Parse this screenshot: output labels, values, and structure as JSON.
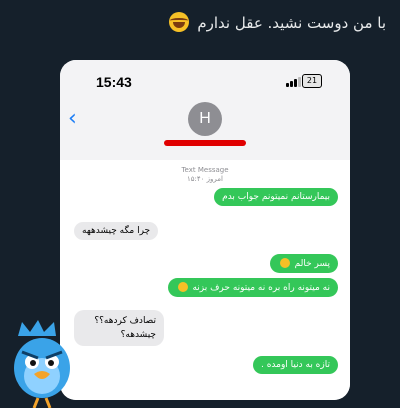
{
  "tweet": {
    "text": "با من دوست نشید. عقل ندارم",
    "emoji": "laugh-cry-icon"
  },
  "status_bar": {
    "time": "15:43",
    "battery": "21"
  },
  "contact": {
    "initial": "H"
  },
  "thread_meta": {
    "line1": "Text Message",
    "line2": "امروز ۱۵:۴۰"
  },
  "messages": [
    {
      "side": "out",
      "text": "بیمارستانم نمیتونم جواب بدم"
    },
    {
      "side": "in",
      "text": "چرا مگه چیشدهھه"
    },
    {
      "side": "out",
      "text": "پسر خالم"
    },
    {
      "side": "out",
      "text": "نه میتونه راه بره نه میتونه حرف بزنه"
    },
    {
      "side": "in",
      "text": "تصادف کردهه؟؟"
    },
    {
      "side": "in",
      "text": "چیشدهه؟"
    },
    {
      "side": "out",
      "text": "تازه به دنیا اومده ."
    }
  ],
  "colors": {
    "outgoing": "#34c759",
    "incoming": "#e9e9eb",
    "ios_blue": "#1a7cf5"
  }
}
